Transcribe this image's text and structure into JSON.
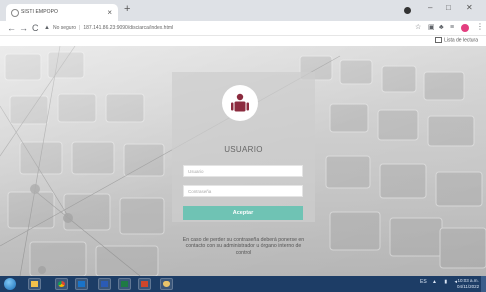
{
  "browser": {
    "tab_title": "SISTI EMPOPO",
    "tab_close": "×",
    "new_tab": "+",
    "security_label": "No seguro",
    "url": "187.141.86.23:9090/disciarca/index.html",
    "reading_list": "Lista de lectura",
    "window_controls": {
      "minimize": "–",
      "maximize": "□",
      "close": "✕"
    },
    "nav": {
      "back": "←",
      "forward": "→",
      "reload": "C"
    },
    "toolbar_icons": [
      "star-icon",
      "cast-icon",
      "extensions-icon",
      "puzzle-icon"
    ],
    "menu": "⋮"
  },
  "login": {
    "title": "USUARIO",
    "username_placeholder": "Usuario",
    "password_placeholder": "Contraseña",
    "accept_label": "Aceptar",
    "help_text": "En caso de perder su contraseña deberá ponerse en contacto con su administrador u órgano interno de control",
    "accent_color": "#6fc3b4",
    "icon_color": "#8b2b3e"
  },
  "taskbar": {
    "apps": [
      "start-orb",
      "file-explorer-icon",
      "chrome-icon",
      "outlook-icon",
      "word-icon",
      "excel-icon",
      "powerpoint-icon",
      "paint-icon"
    ],
    "language": "ES",
    "clock_time": "10:03 a.m.",
    "clock_date": "04/11/2022",
    "background_color": "#1d3d66"
  }
}
